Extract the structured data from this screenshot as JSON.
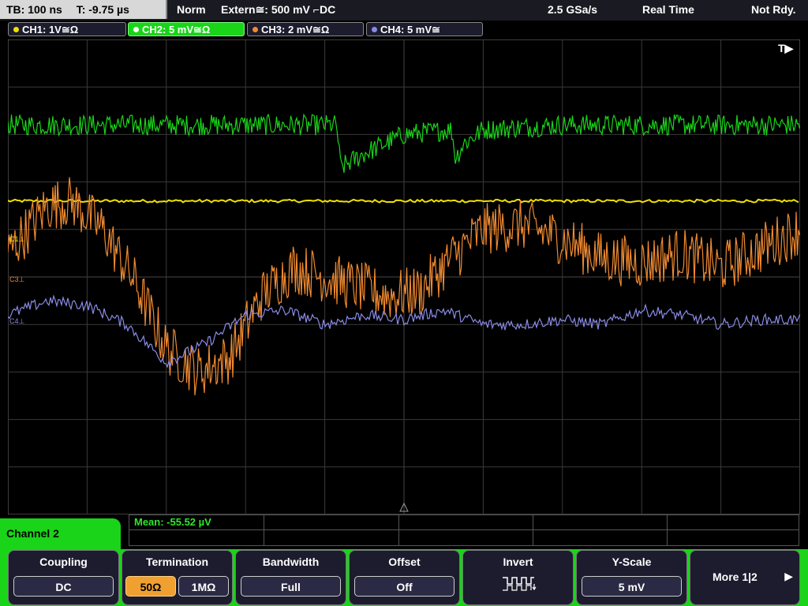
{
  "topbar": {
    "timebase": "TB: 100 ns",
    "trigger_time": "T: -9.75 µs",
    "trigger_mode": "Norm",
    "trigger_source": "Extern≅: 500 mV ⌐DC",
    "sample_rate": "2.5 GSa/s",
    "acq_mode": "Real Time",
    "status": "Not Rdy."
  },
  "channels": [
    {
      "label": "CH1: 1V≅Ω",
      "color": "#f0e000",
      "active": false
    },
    {
      "label": "CH2: 5 mV≅Ω",
      "color": "#19d419",
      "active": true
    },
    {
      "label": "CH3: 2 mV≅Ω",
      "color": "#f08a30",
      "active": false
    },
    {
      "label": "CH4: 5 mV≅",
      "color": "#8a8ae6",
      "active": false
    }
  ],
  "screen": {
    "trigger_marker": "T▶",
    "ch_markers": {
      "c1": "C1⊥",
      "c3": "C3⊥",
      "c4": "C4⊥"
    },
    "grid_color": "#3a3a3a"
  },
  "measurement": {
    "mean": "Mean: -55.52 µV"
  },
  "menu": {
    "title": "Channel 2",
    "coupling": {
      "title": "Coupling",
      "value": "DC"
    },
    "termination": {
      "title": "Termination",
      "opt1": "50Ω",
      "opt2": "1MΩ"
    },
    "bandwidth": {
      "title": "Bandwidth",
      "value": "Full"
    },
    "offset": {
      "title": "Offset",
      "value": "Off"
    },
    "invert": {
      "title": "Invert"
    },
    "yscale": {
      "title": "Y-Scale",
      "value": "5 mV"
    },
    "more": {
      "label": "More 1|2",
      "arrow": "▶"
    }
  },
  "chart_data": {
    "type": "line",
    "x_divisions": 10,
    "y_divisions": 10,
    "series": [
      {
        "name": "CH1",
        "color": "#f0e000",
        "y_div": [
          6.6,
          6.6,
          6.6,
          6.6,
          6.6,
          6.6,
          6.6,
          6.6,
          6.6,
          6.6,
          6.6
        ]
      },
      {
        "name": "CH2",
        "color": "#19d419",
        "x_div": [
          0,
          1,
          2,
          3,
          4,
          4.15,
          4.2,
          4.5,
          5,
          5.6,
          5.65,
          5.75,
          6,
          7,
          8,
          9,
          10
        ],
        "y_div": [
          8.2,
          8.2,
          8.2,
          8.2,
          8.2,
          8.2,
          7.3,
          7.6,
          8.0,
          8.1,
          7.5,
          7.8,
          8.1,
          8.2,
          8.2,
          8.2,
          8.2
        ]
      },
      {
        "name": "CH3",
        "color": "#f08a30",
        "x_div": [
          0,
          0.5,
          0.8,
          1.2,
          1.6,
          2.0,
          2.4,
          2.8,
          3.2,
          3.6,
          4.0,
          4.4,
          4.8,
          5.2,
          5.6,
          6.0,
          6.5,
          7.0,
          7.5,
          8.0,
          8.5,
          9.0,
          9.5,
          10
        ],
        "y_div": [
          5.5,
          6.5,
          6.6,
          6.0,
          4.9,
          3.5,
          3.0,
          3.3,
          4.6,
          5.2,
          5.0,
          4.8,
          4.6,
          4.7,
          5.4,
          6.0,
          6.1,
          5.8,
          5.4,
          5.3,
          5.5,
          5.2,
          5.6,
          6.0
        ]
      },
      {
        "name": "CH4",
        "color": "#8a8ae6",
        "x_div": [
          0,
          0.5,
          1.0,
          1.5,
          2.0,
          2.5,
          3.0,
          3.5,
          4.0,
          4.5,
          5.0,
          5.5,
          6.0,
          6.5,
          7.0,
          7.5,
          8.0,
          8.5,
          9.0,
          9.5,
          10
        ],
        "y_div": [
          4.2,
          4.5,
          4.4,
          4.0,
          3.2,
          3.6,
          4.2,
          4.3,
          4.0,
          4.2,
          4.1,
          4.3,
          4.0,
          4.0,
          4.1,
          4.0,
          4.3,
          4.2,
          4.0,
          4.1,
          4.1
        ]
      }
    ]
  }
}
